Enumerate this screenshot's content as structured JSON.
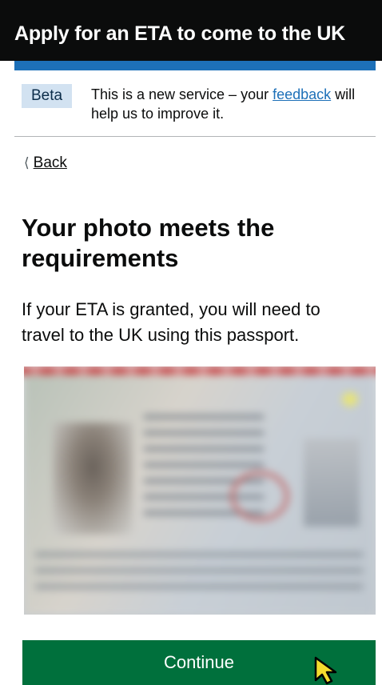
{
  "header": {
    "title": "Apply for an ETA to come to the UK"
  },
  "phase_banner": {
    "tag": "Beta",
    "text_before": "This is a new service – your ",
    "link": "feedback",
    "text_after": " will help us to improve it."
  },
  "back_link": {
    "label": "Back",
    "icon": "chevron-left-icon"
  },
  "main": {
    "heading": "Your photo meets the requirements",
    "body": "If your ETA is granted, you will need to travel to the UK using this passport."
  },
  "continue_button": {
    "label": "Continue"
  },
  "colors": {
    "header_bg": "#0b0c0c",
    "accent_blue": "#1d70b8",
    "button_green": "#00703c",
    "cursor_yellow": "#f3dc2e"
  }
}
